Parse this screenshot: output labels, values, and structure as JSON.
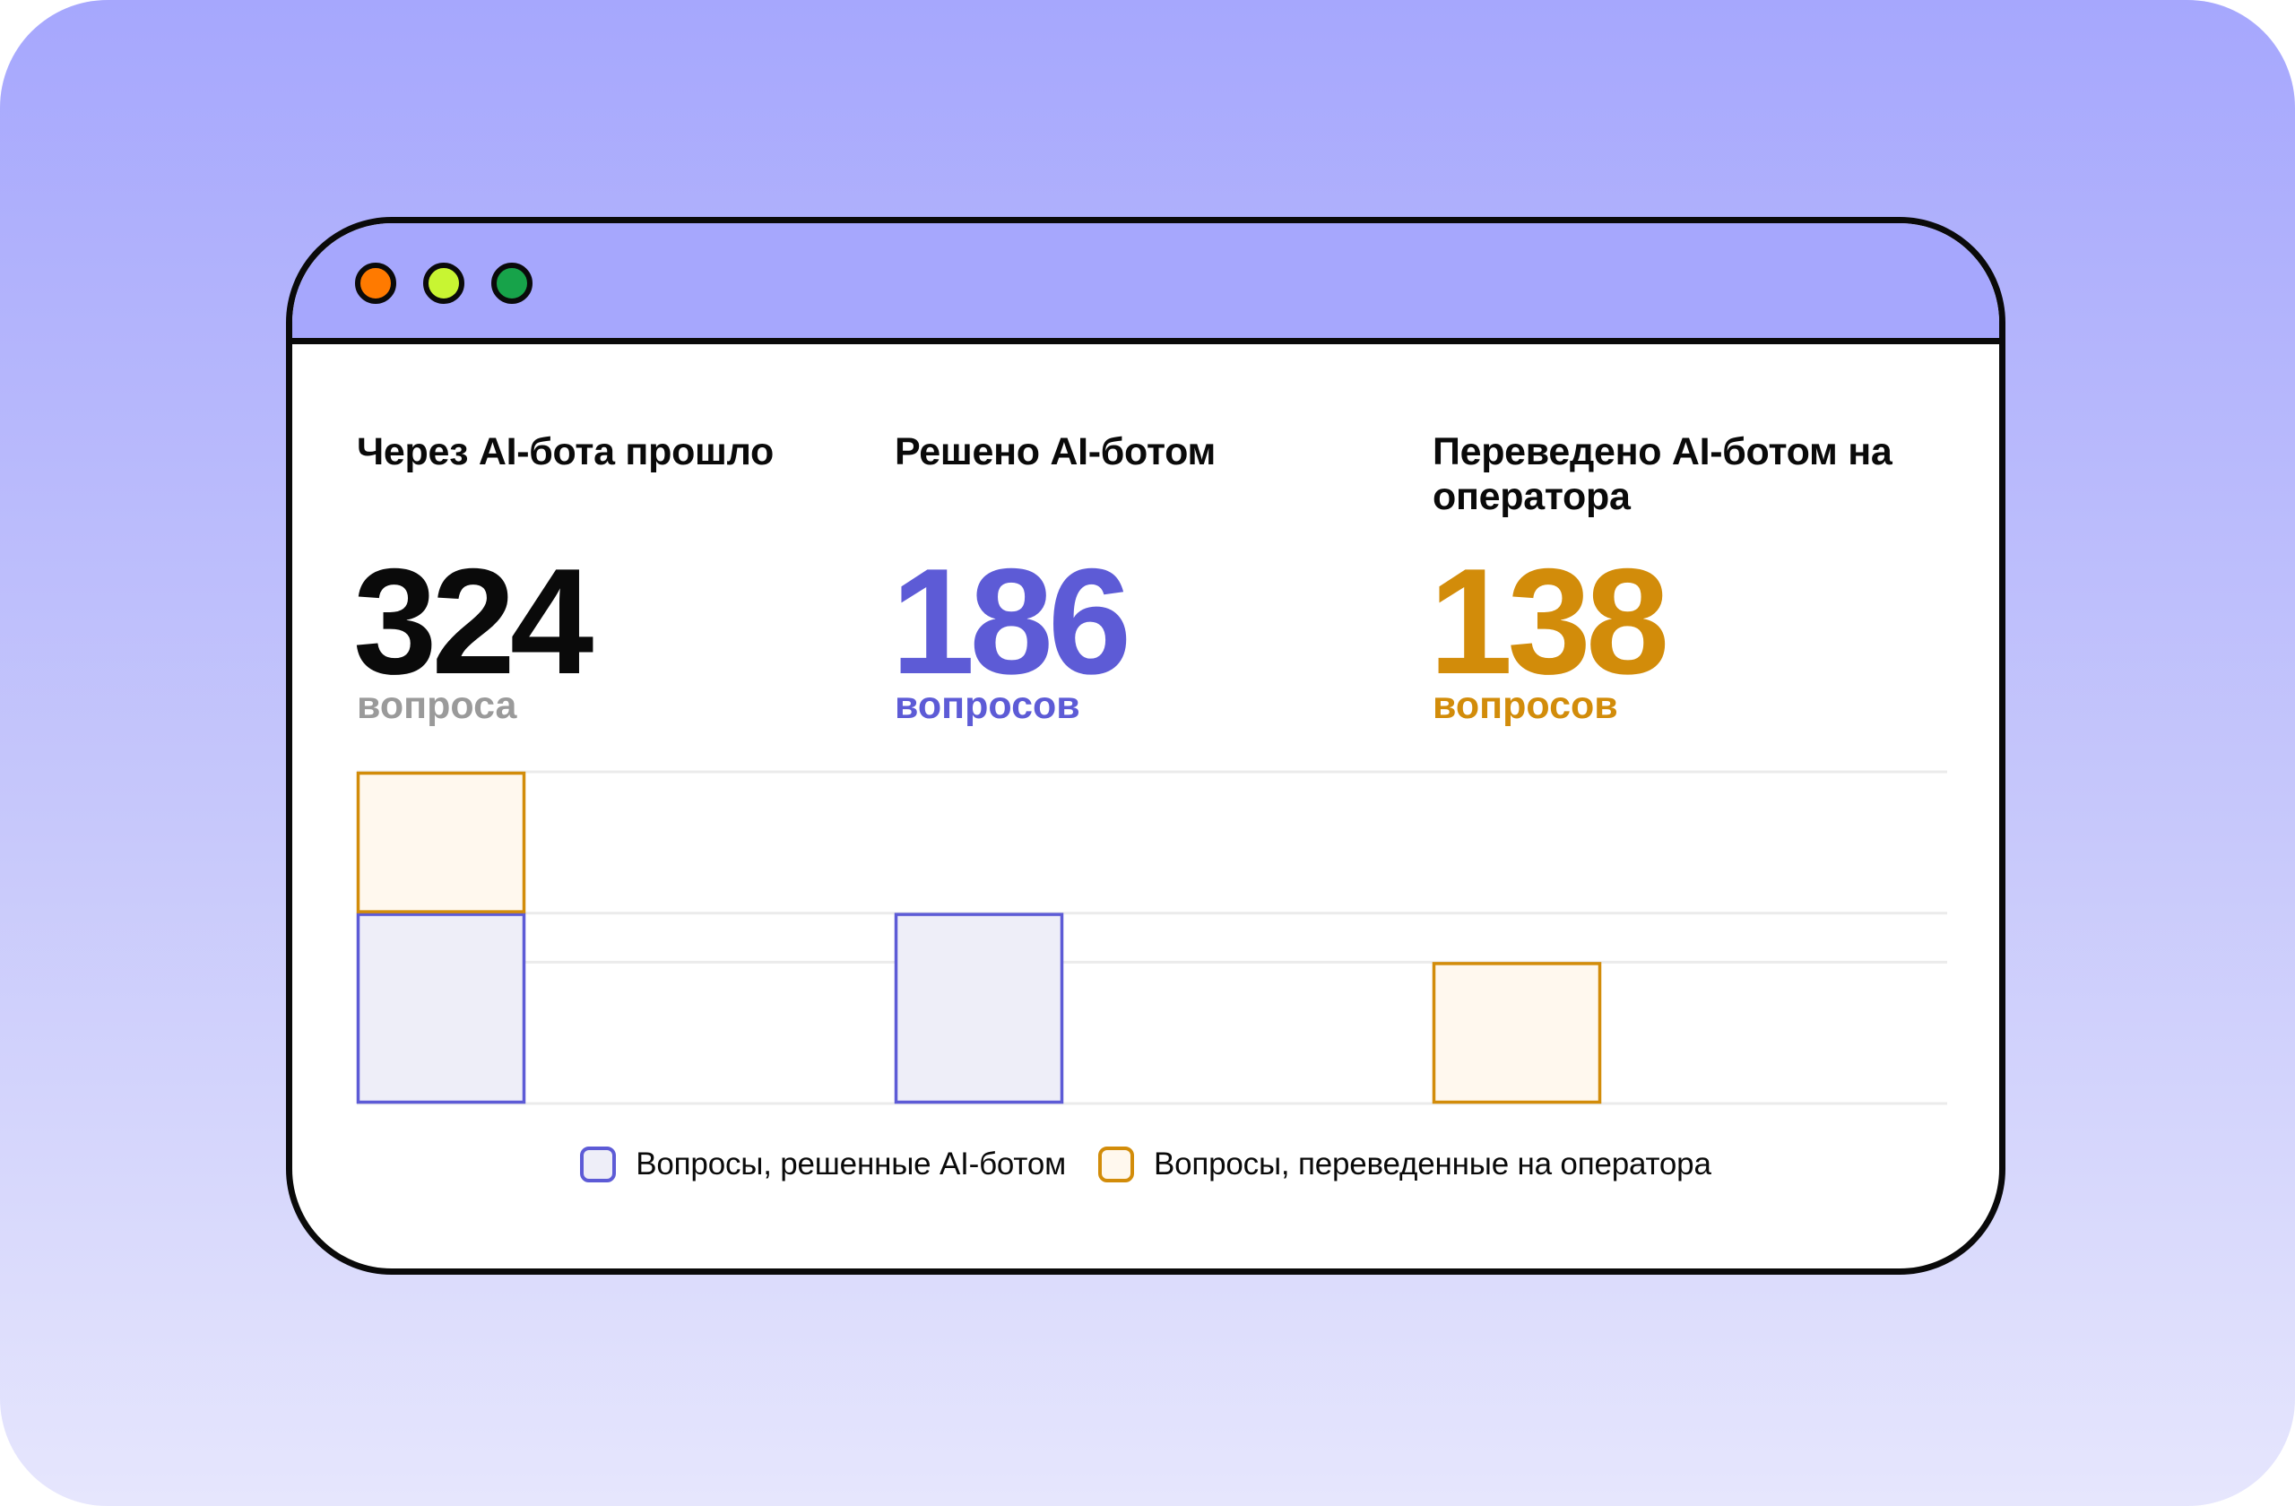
{
  "window": {
    "controls": [
      {
        "name": "close",
        "color": "#ff7a00"
      },
      {
        "name": "minimize",
        "color": "#c8f532"
      },
      {
        "name": "maximize",
        "color": "#17a34a"
      }
    ]
  },
  "stats": [
    {
      "label": "Через AI-бота прошло",
      "number": "324",
      "unit": "вопроса",
      "number_color": "#0a0a0a",
      "unit_color": "#9a9a9a"
    },
    {
      "label": "Решено AI-ботом",
      "number": "186",
      "unit": "вопросов",
      "number_color": "#5d5bd6",
      "unit_color": "#5d5bd6"
    },
    {
      "label": "Переведено AI-ботом на оператора",
      "number": "138",
      "unit": "вопросов",
      "number_color": "#d28c0a",
      "unit_color": "#d28c0a"
    }
  ],
  "colors": {
    "solved_stroke": "#5d5bd6",
    "solved_fill": "#eeeef8",
    "transferred_stroke": "#d28c0a",
    "transferred_fill": "#fff8ee",
    "gridline": "#ebebeb"
  },
  "chart_data": {
    "type": "bar",
    "stacked": true,
    "categories": [
      "Через AI-бота прошло",
      "Решено AI-ботом",
      "Переведено AI-ботом на оператора"
    ],
    "series": [
      {
        "name": "Вопросы, решенные AI-ботом",
        "values": [
          186,
          186,
          0
        ]
      },
      {
        "name": "Вопросы, переведенные на оператора",
        "values": [
          138,
          0,
          138
        ]
      }
    ],
    "ylim": [
      0,
      324
    ],
    "grid": true,
    "legend": "bottom-center"
  },
  "legend": [
    {
      "label": "Вопросы, решенные AI-ботом"
    },
    {
      "label": "Вопросы, переведенные на оператора"
    }
  ]
}
